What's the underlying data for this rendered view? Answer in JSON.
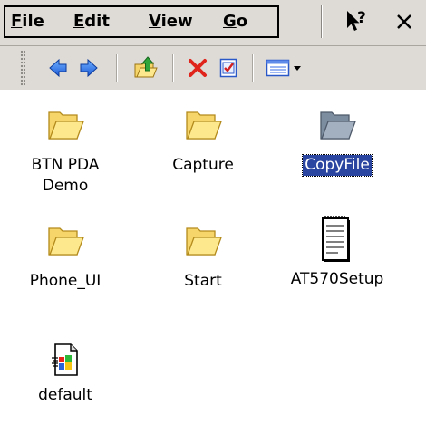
{
  "menubar": {
    "items": [
      {
        "label": "File",
        "accel": "F",
        "rest": "ile"
      },
      {
        "label": "Edit",
        "accel": "E",
        "rest": "dit"
      },
      {
        "label": "View",
        "accel": "V",
        "rest": "iew"
      },
      {
        "label": "Go",
        "accel": "G",
        "rest": "o"
      }
    ],
    "help_icon": "help-pointer-icon",
    "close_icon": "close-icon"
  },
  "toolbar": {
    "buttons": [
      {
        "name": "back-button",
        "icon": "arrow-left-icon"
      },
      {
        "name": "forward-button",
        "icon": "arrow-right-icon"
      },
      {
        "name": "up-folder-button",
        "icon": "folder-up-icon"
      },
      {
        "name": "delete-button",
        "icon": "delete-x-icon"
      },
      {
        "name": "properties-button",
        "icon": "properties-check-icon"
      },
      {
        "name": "view-menu-button",
        "icon": "view-details-icon"
      }
    ],
    "colors": {
      "arrow": "#1f5bd6",
      "delete": "#e0231b"
    }
  },
  "files": [
    {
      "name": "BTN PDA Demo",
      "line1": "BTN PDA",
      "line2": "Demo",
      "type": "folder",
      "selected": false
    },
    {
      "name": "Capture",
      "line1": "Capture",
      "line2": "",
      "type": "folder",
      "selected": false
    },
    {
      "name": "CopyFile",
      "line1": "CopyFile",
      "line2": "",
      "type": "folder-selected",
      "selected": true
    },
    {
      "name": "Phone_UI",
      "line1": "Phone_UI",
      "line2": "",
      "type": "folder",
      "selected": false
    },
    {
      "name": "Start",
      "line1": "Start",
      "line2": "",
      "type": "folder",
      "selected": false
    },
    {
      "name": "AT570Setup",
      "line1": "AT570Setup",
      "line2": "",
      "type": "document",
      "selected": false
    },
    {
      "name": "default",
      "line1": "default",
      "line2": "",
      "type": "word-document",
      "selected": false
    }
  ],
  "colors": {
    "chrome": "#dedbd6",
    "selection": "#2a46a1",
    "folder_fill": "#fde88e",
    "folder_stroke": "#b38a1c"
  }
}
